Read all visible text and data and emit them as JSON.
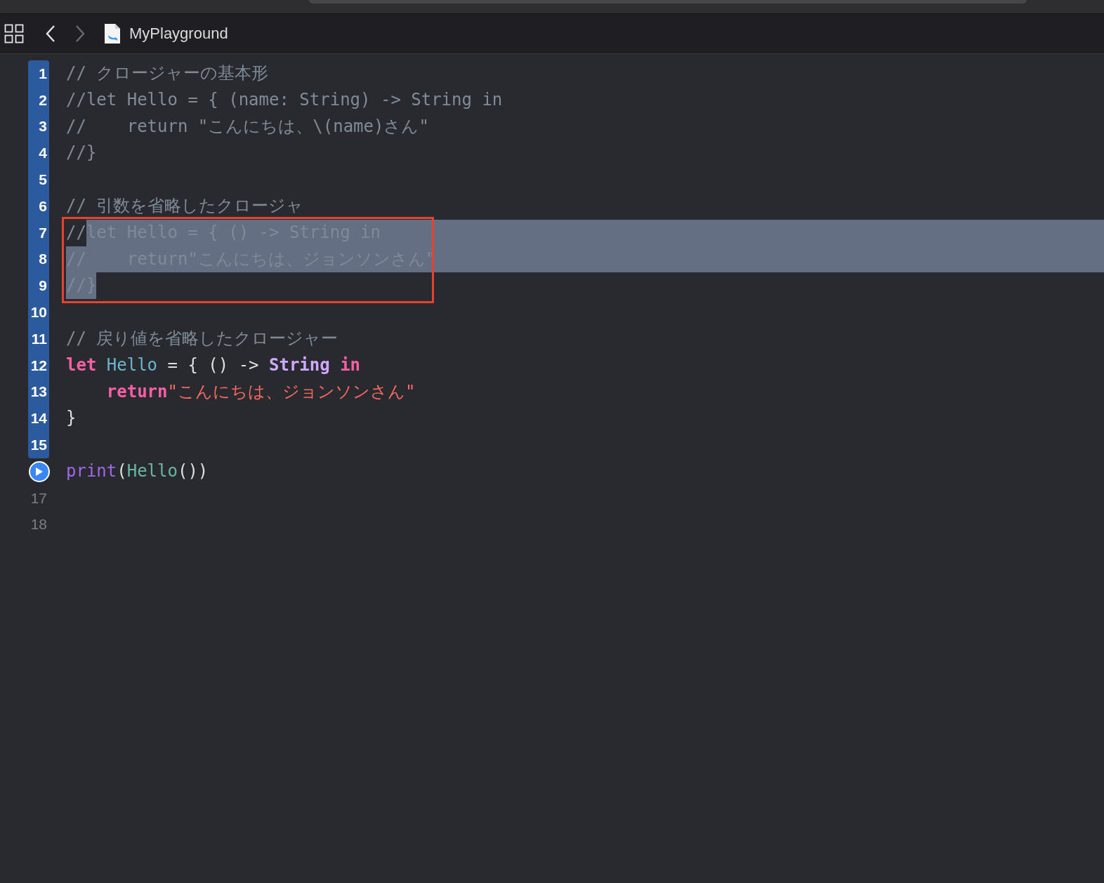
{
  "toolbar": {
    "title": "MyPlayground"
  },
  "lines": [
    {
      "number": "1",
      "kind": "code",
      "executed": true,
      "tokens": [
        {
          "kind": "comment",
          "text": "// クロージャーの基本形",
          "selected": false
        }
      ]
    },
    {
      "number": "2",
      "kind": "code",
      "executed": true,
      "tokens": [
        {
          "kind": "comment",
          "text": "//let Hello = { (name: String) -> String in",
          "selected": false
        }
      ]
    },
    {
      "number": "3",
      "kind": "code",
      "executed": true,
      "tokens": [
        {
          "kind": "comment",
          "text": "//    return \"こんにちは、\\(name)さん\"",
          "selected": false
        }
      ]
    },
    {
      "number": "4",
      "kind": "code",
      "executed": true,
      "tokens": [
        {
          "kind": "comment",
          "text": "//}",
          "selected": false
        }
      ]
    },
    {
      "number": "5",
      "kind": "code",
      "executed": true
    },
    {
      "number": "6",
      "kind": "code",
      "executed": true,
      "tokens": [
        {
          "kind": "comment",
          "text": "// 引数を省略したクロージャ",
          "selected": false
        }
      ]
    },
    {
      "number": "7",
      "kind": "code",
      "executed": true,
      "boxed": true,
      "selected_to_end": true,
      "tokens": [
        {
          "kind": "comment",
          "text": "//",
          "selected": false
        },
        {
          "kind": "comment",
          "text": "let Hello = { () -> String in",
          "selected": true
        }
      ]
    },
    {
      "number": "8",
      "kind": "code",
      "executed": true,
      "boxed": true,
      "selected_to_end": true,
      "tokens": [
        {
          "kind": "comment",
          "text": "//    return\"こんにちは、ジョンソンさん\"",
          "selected": true
        }
      ]
    },
    {
      "number": "9",
      "kind": "code",
      "executed": true,
      "boxed": true,
      "tokens": [
        {
          "kind": "comment",
          "text": "//}",
          "selected": true
        }
      ]
    },
    {
      "number": "10",
      "kind": "code",
      "executed": true
    },
    {
      "number": "11",
      "kind": "code",
      "executed": true,
      "tokens": [
        {
          "kind": "comment",
          "text": "// 戻り値を省略したクロージャー",
          "selected": false
        }
      ]
    },
    {
      "number": "12",
      "kind": "code",
      "executed": true,
      "tokens": [
        {
          "kind": "keyword",
          "text": "let",
          "selected": false
        },
        {
          "kind": "declaration",
          "text": " Hello",
          "selected": false
        },
        {
          "kind": "plain",
          "text": " = { () -> ",
          "selected": false
        },
        {
          "kind": "type",
          "text": "String",
          "selected": false
        },
        {
          "kind": "keyword",
          "text": " in",
          "selected": false
        }
      ]
    },
    {
      "number": "13",
      "kind": "code",
      "executed": true,
      "tokens": [
        {
          "kind": "keyword",
          "text": "    return",
          "selected": false
        },
        {
          "kind": "string",
          "text": "\"こんにちは、ジョンソンさん\"",
          "selected": false
        }
      ]
    },
    {
      "number": "14",
      "kind": "code",
      "executed": true,
      "tokens": [
        {
          "kind": "plain",
          "text": "}",
          "selected": false
        }
      ]
    },
    {
      "number": "15",
      "kind": "code",
      "executed": true
    },
    {
      "kind": "run",
      "tokens": [
        {
          "kind": "function",
          "text": "print",
          "selected": false
        },
        {
          "kind": "plain",
          "text": "(",
          "selected": false
        },
        {
          "kind": "call",
          "text": "Hello",
          "selected": false
        },
        {
          "kind": "plain",
          "text": "())",
          "selected": false
        }
      ]
    },
    {
      "number": "17",
      "kind": "code",
      "executed": false
    },
    {
      "number": "18",
      "kind": "code",
      "executed": false
    }
  ]
}
